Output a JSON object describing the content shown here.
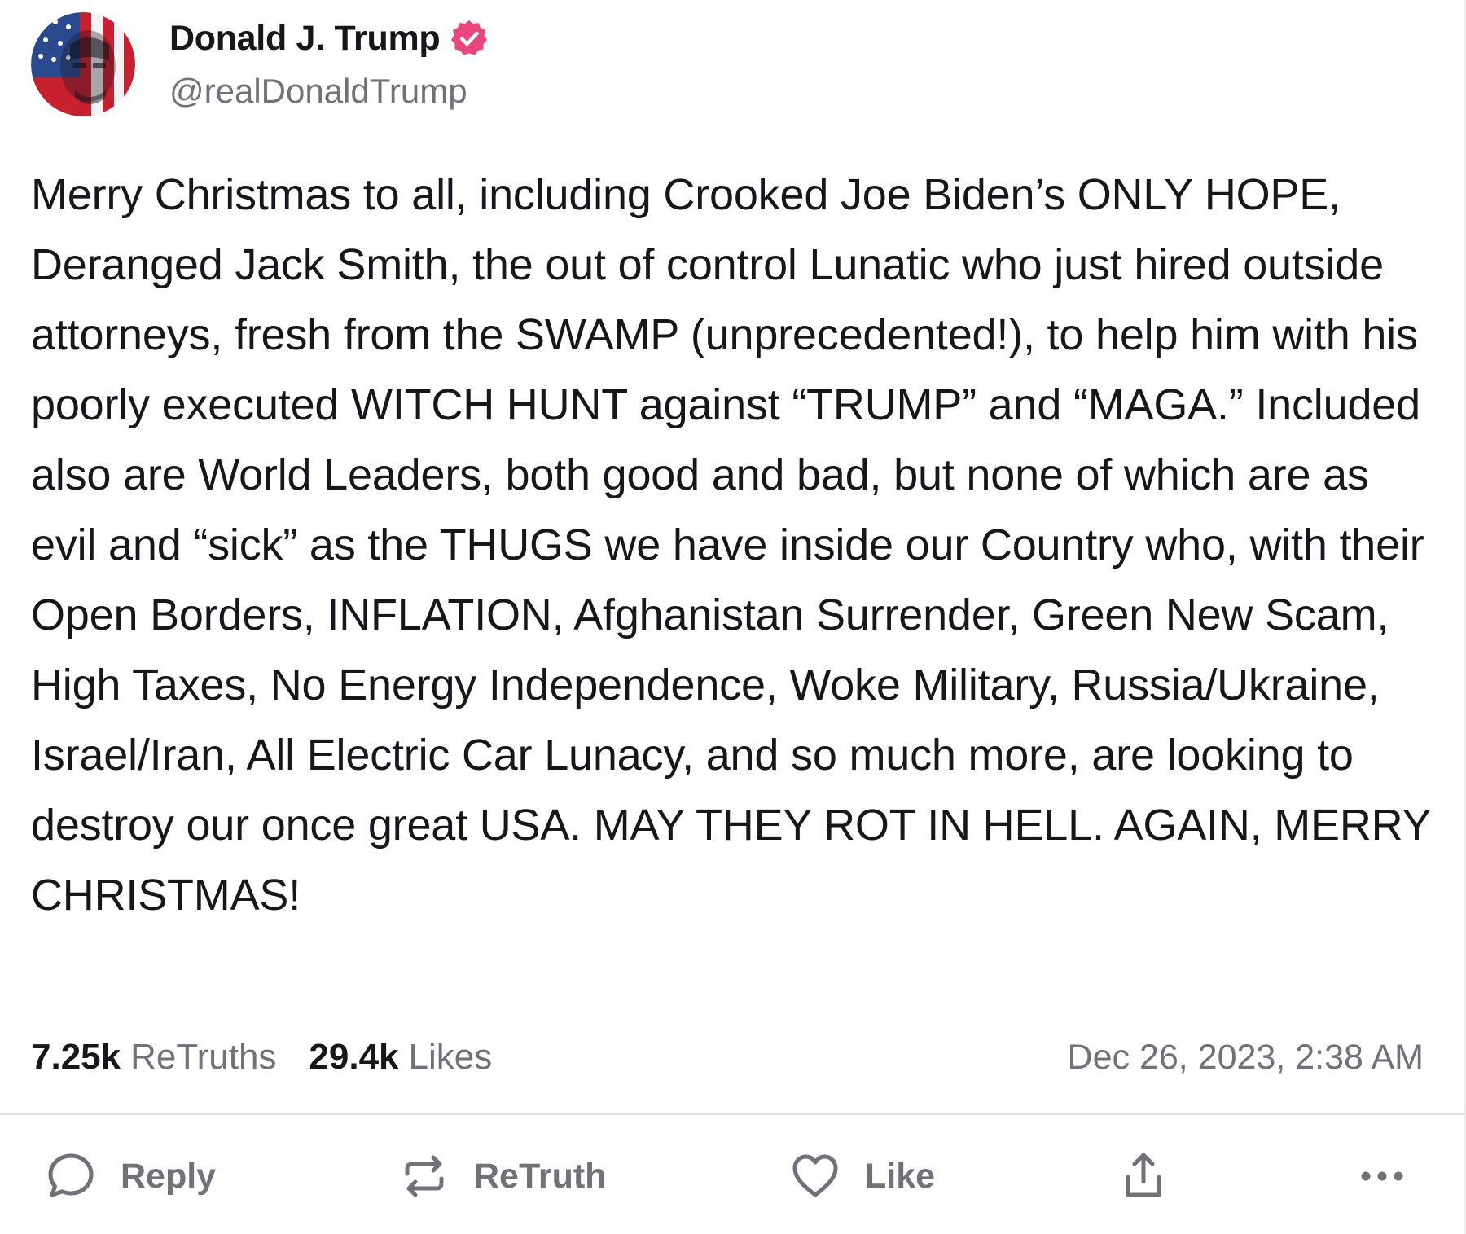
{
  "author": {
    "display_name": "Donald J. Trump",
    "handle": "@realDonaldTrump",
    "verified": true,
    "avatar_icon": "flag-portrait-avatar"
  },
  "post": {
    "text": "Merry Christmas to all, including Crooked Joe Biden’s ONLY HOPE, Deranged Jack Smith, the out of control Lunatic who just hired outside attorneys, fresh from the SWAMP (unprecedented!), to help him with his poorly executed WITCH HUNT against “TRUMP” and “MAGA.” Included also are World Leaders, both good and bad, but none of which are as evil and “sick” as the THUGS we have inside our Country who, with their Open Borders, INFLATION, Afghanistan Surrender, Green New Scam, High Taxes, No Energy Independence, Woke Military, Russia/Ukraine, Israel/Iran, All Electric Car Lunacy, and so much more, are looking to destroy our once great USA. MAY THEY ROT IN HELL. AGAIN, MERRY CHRISTMAS!"
  },
  "stats": {
    "retruths_count": "7.25k",
    "retruths_label": "ReTruths",
    "likes_count": "29.4k",
    "likes_label": "Likes",
    "timestamp": "Dec 26, 2023, 2:38 AM"
  },
  "actions": {
    "reply_label": "Reply",
    "retruth_label": "ReTruth",
    "like_label": "Like",
    "share_icon": "share-icon",
    "more_icon": "more-icon"
  },
  "colors": {
    "text_primary": "#16161b",
    "text_secondary": "#71717a",
    "verified_badge": "#e8467c",
    "divider": "#e4e4e7"
  }
}
